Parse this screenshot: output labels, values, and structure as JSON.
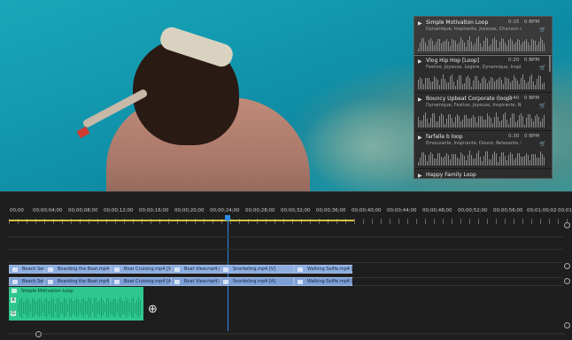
{
  "music_panel": {
    "tracks": [
      {
        "title": "Simple Motivation Loop",
        "duration": "0:15",
        "bpm": "0 BPM",
        "tags": "Dynamique, Inspirante, Joyeuse, Chanson de...",
        "selected": true
      },
      {
        "title": "Vlog Hip Hop [Loop]",
        "duration": "0:20",
        "bpm": "0 BPM",
        "tags": "Festive, Joyeuse, Légère, Dynamique, Inspira...",
        "selected": false
      },
      {
        "title": "Bouncy Upbeat Corporate (loop)",
        "duration": "0:40",
        "bpm": "0 BPM",
        "tags": "Dynamique, Festive, Joyeuse, Inspirante, Neu...",
        "selected": false
      },
      {
        "title": "farfalle b loop",
        "duration": "0:30",
        "bpm": "0 BPM",
        "tags": "Émouvante, Inspirante, Douce, Relaxante, Len...",
        "selected": false
      },
      {
        "title": "Happy Family Loop",
        "duration": "",
        "bpm": "",
        "tags": "",
        "selected": false
      }
    ],
    "play_icon": "play-icon",
    "cart_icon": "cart-icon"
  },
  "timeline": {
    "timecodes": [
      "00;00",
      "00;00;04;00",
      "00;00;08;00",
      "00;00;12;00",
      "00;00;16;00",
      "00;00;20;00",
      "00;00;24;00",
      "00;00;28;00",
      "00;00;32;00",
      "00;00;36;00",
      "00;00;40;00",
      "00;00;44;00",
      "00;00;48;00",
      "00;00;52;00",
      "00;00;56;00",
      "00;01;00;02",
      "00;01"
    ],
    "video_clips": [
      "Beach Selfi",
      "Boarding the Boat.mp4 [V]",
      "Boat Cruising.mp4 [V]",
      "Boat View.mp4 [V]",
      "Snorkeling.mp4 [V]",
      "Walking Selfie.mp4 [V]"
    ],
    "audio_clips": [
      "Beach Selfi",
      "Boarding the Boat.mp4 [A]",
      "Boat Cruising.mp4 [A]",
      "Boat View.mp4 [A]",
      "Snorkeling.mp4 [A]",
      "Walking Selfie.mp4 [A]"
    ],
    "music_clip": "Simple Motivation Loop",
    "music_clip_fx": [
      "A",
      "G"
    ]
  },
  "colors": {
    "clip_blue": "#8eaee0",
    "music_green": "#2ec78f",
    "playhead": "#2d8ceb",
    "workarea": "#d7c243"
  }
}
